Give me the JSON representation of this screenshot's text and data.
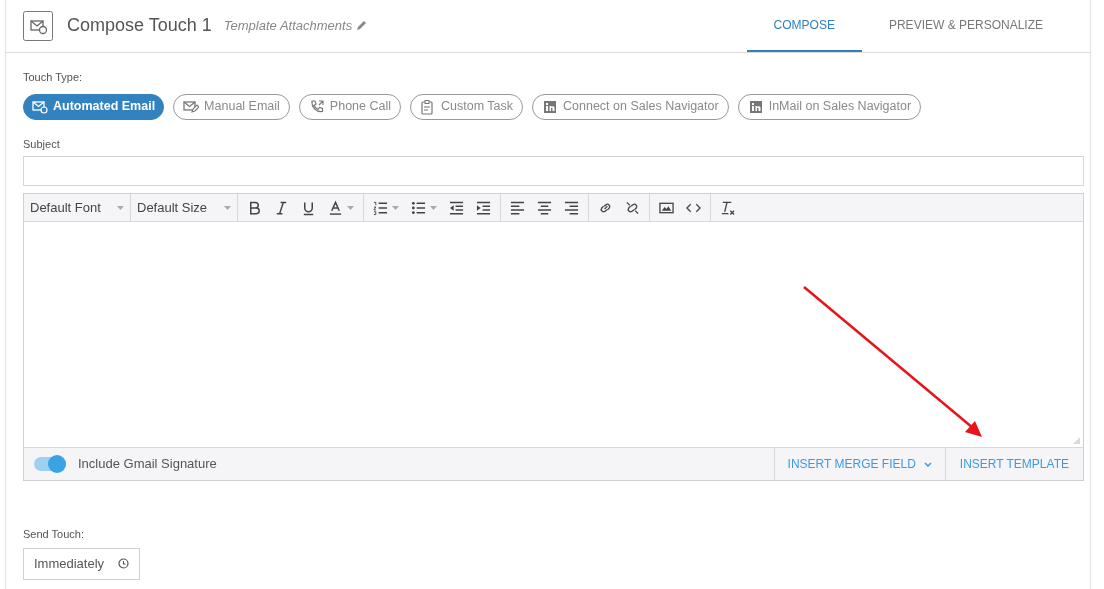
{
  "header": {
    "title": "Compose Touch 1",
    "subtitle": "Template Attachments"
  },
  "tabs": [
    {
      "label": "COMPOSE",
      "selected": true
    },
    {
      "label": "PREVIEW & PERSONALIZE",
      "selected": false
    }
  ],
  "touch_type": {
    "label": "Touch Type:",
    "options": [
      {
        "label": "Automated Email",
        "kind": "auto-email",
        "selected": true
      },
      {
        "label": "Manual Email",
        "kind": "manual-email",
        "selected": false
      },
      {
        "label": "Phone Call",
        "kind": "phone",
        "selected": false
      },
      {
        "label": "Custom Task",
        "kind": "task",
        "selected": false
      },
      {
        "label": "Connect on Sales Navigator",
        "kind": "linkedin",
        "selected": false
      },
      {
        "label": "InMail on Sales Navigator",
        "kind": "linkedin",
        "selected": false
      }
    ]
  },
  "subject": {
    "label": "Subject"
  },
  "editor": {
    "font": "Default Font",
    "size": "Default Size"
  },
  "footer": {
    "signature_label": "Include Gmail Signature",
    "signature_on": true,
    "merge_field": "INSERT MERGE FIELD",
    "template": "INSERT TEMPLATE"
  },
  "send_touch": {
    "label": "Send Touch:",
    "value": "Immediately"
  }
}
